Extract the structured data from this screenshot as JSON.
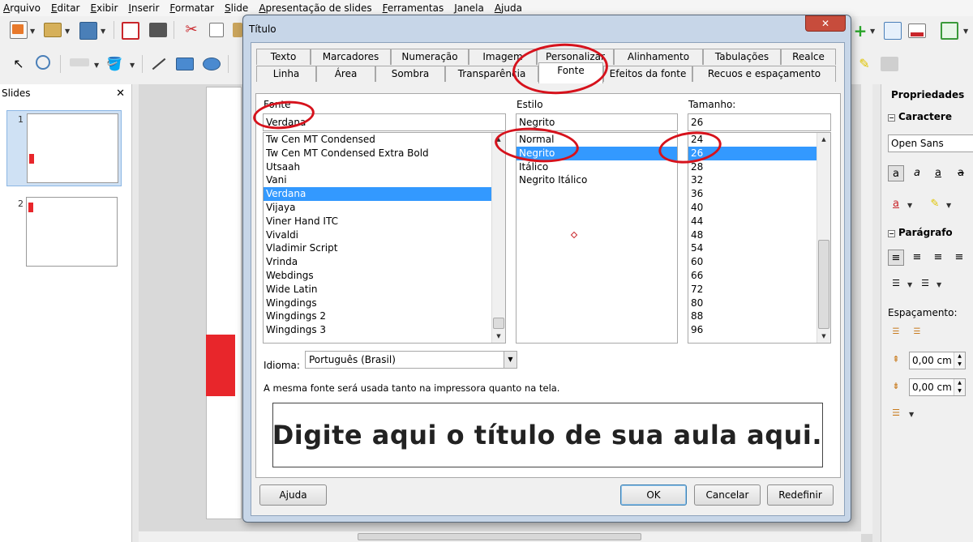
{
  "menu": [
    {
      "label": "Arquivo"
    },
    {
      "label": "Editar"
    },
    {
      "label": "Exibir"
    },
    {
      "label": "Inserir"
    },
    {
      "label": "Formatar"
    },
    {
      "label": "Slide"
    },
    {
      "label": "Apresentação de slides"
    },
    {
      "label": "Ferramentas"
    },
    {
      "label": "Janela"
    },
    {
      "label": "Ajuda"
    }
  ],
  "slides_panel": {
    "title": "Slides",
    "close_glyph": "✕",
    "slides": [
      {
        "number": "1"
      },
      {
        "number": "2"
      }
    ]
  },
  "sidebar": {
    "title": "Propriedades",
    "character_section": "Caractere",
    "font_name": "Open Sans",
    "paragraph_section": "Parágrafo",
    "spacing_label": "Espaçamento:",
    "spacing_above": "0,00 cm",
    "spacing_below": "0,00 cm"
  },
  "dialog": {
    "title": "Título",
    "close_glyph": "✕",
    "tabs_row1": [
      "Texto",
      "Marcadores",
      "Numeração",
      "Imagem",
      "Personalizar",
      "Alinhamento",
      "Tabulações",
      "Realce"
    ],
    "tabs_row2": [
      "Linha",
      "Área",
      "Sombra",
      "Transparência",
      "Fonte",
      "Efeitos da fonte",
      "Recuos e espaçamento"
    ],
    "active_tab": "Fonte",
    "font_label": "Fonte",
    "font_value": "Verdana",
    "font_list": [
      "Tw Cen MT Condensed",
      "Tw Cen MT Condensed Extra Bold",
      "Utsaah",
      "Vani",
      "Verdana",
      "Vijaya",
      "Viner Hand ITC",
      "Vivaldi",
      "Vladimir Script",
      "Vrinda",
      "Webdings",
      "Wide Latin",
      "Wingdings",
      "Wingdings 2",
      "Wingdings 3"
    ],
    "font_selected": "Verdana",
    "style_label": "Estilo",
    "style_value": "Negrito",
    "style_list": [
      "Normal",
      "Negrito",
      "Itálico",
      "Negrito Itálico"
    ],
    "style_selected": "Negrito",
    "size_label": "Tamanho:",
    "size_value": "26",
    "size_list": [
      "24",
      "26",
      "28",
      "32",
      "36",
      "40",
      "44",
      "48",
      "54",
      "60",
      "66",
      "72",
      "80",
      "88",
      "96"
    ],
    "size_selected": "26",
    "language_label": "Idioma:",
    "language_value": "Português (Brasil)",
    "info_text": "A mesma fonte será usada tanto na impressora quanto na tela.",
    "preview_text": "Digite aqui o título de sua aula aqui.",
    "buttons": {
      "help": "Ajuda",
      "ok": "OK",
      "cancel": "Cancelar",
      "reset": "Redefinir"
    }
  },
  "colors": {
    "accent_selection": "#3399ff",
    "annotation": "#d6121c",
    "slide_red": "#e8262b"
  }
}
